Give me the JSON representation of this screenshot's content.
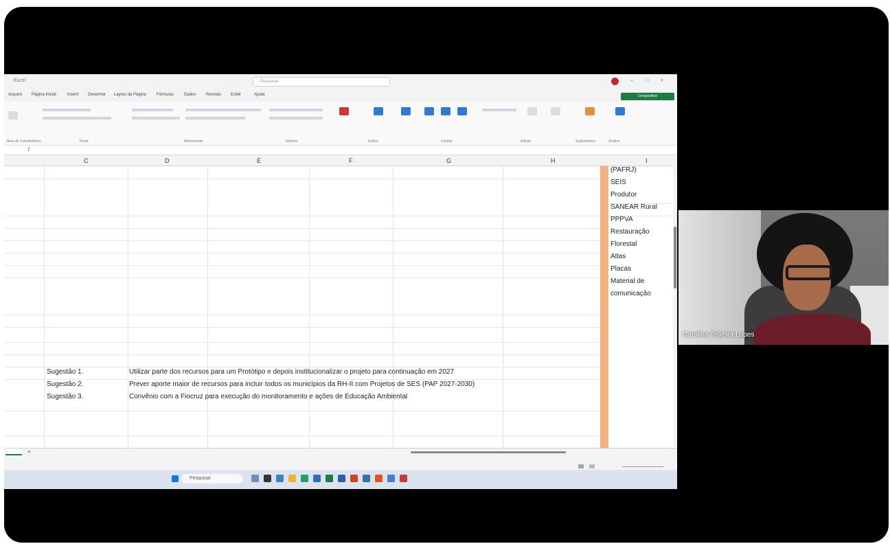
{
  "window": {
    "document_title": "Excel",
    "search_placeholder": "Pesquisar",
    "share_label": "Compartilhar"
  },
  "menu": [
    "Arquivo",
    "Página Inicial",
    "Inserir",
    "Desenhar",
    "Layout da Página",
    "Fórmulas",
    "Dados",
    "Revisão",
    "Exibir",
    "Ajuda"
  ],
  "ribbon_groups": [
    "Área de Transferência",
    "Fonte",
    "Alinhamento",
    "Número",
    "Estilos",
    "Células",
    "Edição",
    "Suplementos",
    "Análise"
  ],
  "columns": [
    "C",
    "D",
    "E",
    "F",
    "G",
    "H",
    "I"
  ],
  "column_i_cells": [
    "(PAFRJ)",
    "SEIS",
    "Produtor",
    "SANEAR Rural",
    "PPPVA",
    "Restauração",
    "Florestal",
    "Atlas",
    "Placas",
    "Material de",
    "comunicação"
  ],
  "suggestions": [
    {
      "label": "Sugestão 1.",
      "text": "Utilizar parte dos recursos para um Protótipo e depois institucionalizar o projeto para continuação em 2027"
    },
    {
      "label": "Sugestão 2.",
      "text": "Prever aporte maior de recursos para incluir todos os municípios da RH-II com Projetos de SES (PAP 2027-2030)"
    },
    {
      "label": "Sugestão 3.",
      "text": "Convênio com a Fiocruz para execução do monitoramento e ações de Educação Ambiental"
    }
  ],
  "taskbar": {
    "search_label": "Pesquisar"
  },
  "participant": {
    "name": "Carolina Teixeira Lopes"
  }
}
